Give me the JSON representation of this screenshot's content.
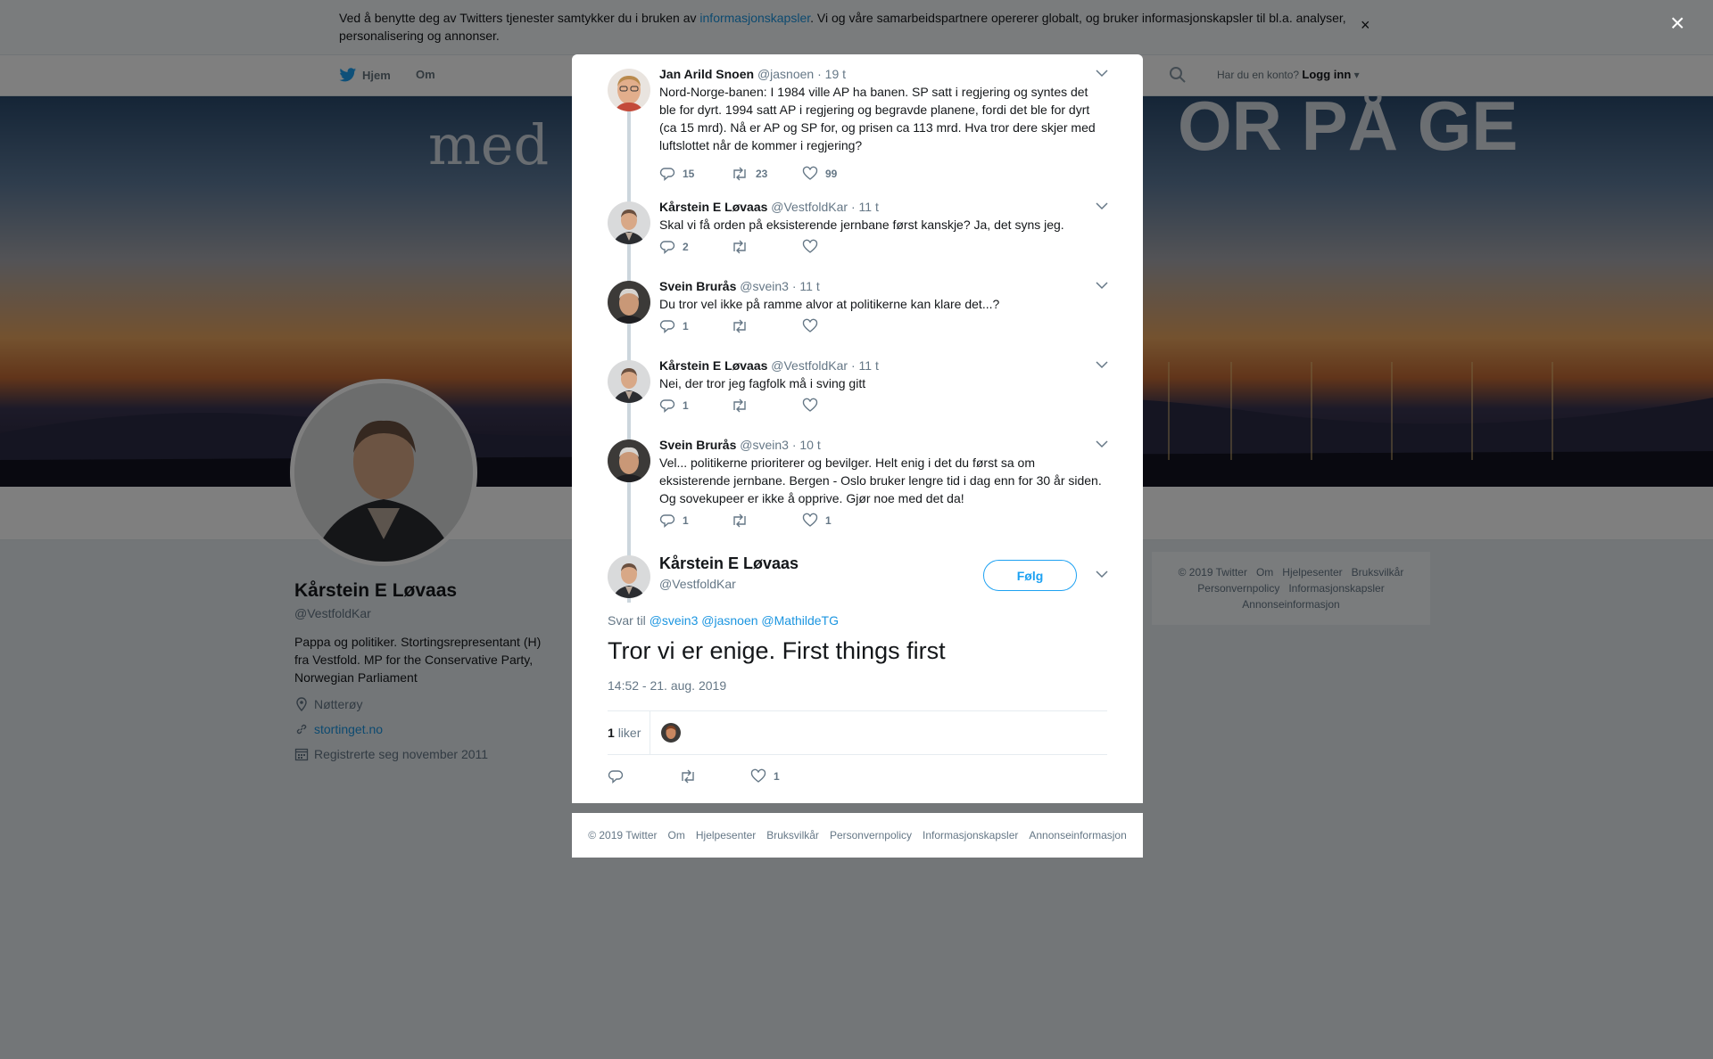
{
  "cookie_banner": {
    "text_before": "Ved å benytte deg av Twitters tjenester samtykker du i bruken av ",
    "link": "informasjonskapsler",
    "text_after": ". Vi og våre samarbeidspartnere opererer globalt, og bruker informasjonskapsler til bl.a. analyser, personalisering og annonser.",
    "close": "×"
  },
  "nav": {
    "home": "Hjem",
    "about": "Om",
    "account_prompt": "Har du en konto?",
    "login": "Logg inn"
  },
  "banner": {
    "line1": "med ",
    "line2": "OR PÅ GE"
  },
  "profile": {
    "name": "Kårstein E Løvaas",
    "handle": "@VestfoldKar",
    "bio": "Pappa og politiker. Stortingsrepresentant (H) fra Vestfold. MP for the Conservative Party, Norwegian Parliament",
    "location": "Nøtterøy",
    "url": "stortinget.no",
    "joined": "Registrerte seg november 2011"
  },
  "side_footer": [
    "© 2019 Twitter",
    "Om",
    "Hjelpesenter",
    "Bruksvilkår",
    "Personvernpolicy",
    "Informasjonskapsler",
    "Annonseinformasjon"
  ],
  "modal_close": "×",
  "thread": [
    {
      "name": "Jan Arild Snoen",
      "handle": "@jasnoen",
      "time": "· 19 t",
      "text": "Nord-Norge-banen: I 1984 ville AP ha banen. SP satt i regjering og syntes det ble for dyrt. 1994 satt AP i regjering og begravde planene, fordi det ble for dyrt (ca 15 mrd). Nå er AP og SP for, og prisen ca 113 mrd. Hva tror dere skjer med luftslottet når de kommer i regjering?",
      "replies": "15",
      "retweets": "23",
      "likes": "99"
    },
    {
      "name": "Kårstein E Løvaas",
      "handle": "@VestfoldKar",
      "time": "· 11 t",
      "text": "Skal vi få orden på eksisterende jernbane først kanskje? Ja, det syns jeg.",
      "replies": "2",
      "retweets": "",
      "likes": ""
    },
    {
      "name": "Svein Brurås",
      "handle": "@svein3",
      "time": "· 11 t",
      "text": "Du tror vel ikke på ramme alvor at politikerne kan klare det...?",
      "replies": "1",
      "retweets": "",
      "likes": ""
    },
    {
      "name": "Kårstein E Løvaas",
      "handle": "@VestfoldKar",
      "time": "· 11 t",
      "text": "Nei, der tror jeg fagfolk må i sving gitt",
      "replies": "1",
      "retweets": "",
      "likes": ""
    },
    {
      "name": "Svein Brurås",
      "handle": "@svein3",
      "time": "· 10 t",
      "text": "Vel... politikerne prioriterer og bevilger. Helt enig i det du først sa om eksisterende jernbane. Bergen - Oslo bruker lengre tid i dag enn for 30 år siden. Og sovekupeer er ikke å opprive. Gjør noe med det da!",
      "replies": "1",
      "retweets": "",
      "likes": "1"
    }
  ],
  "main_tweet": {
    "name": "Kårstein E Løvaas",
    "handle": "@VestfoldKar",
    "follow": "Følg",
    "reply_to_label": "Svar til",
    "mentions": [
      "@svein3",
      "@jasnoen",
      "@MathildeTG"
    ],
    "text": "Tror vi er enige. First things first",
    "timestamp": "14:52 - 21. aug. 2019",
    "likes_count": "1",
    "likes_label": "liker",
    "action_likes": "1"
  },
  "modal_footer": [
    "© 2019 Twitter",
    "Om",
    "Hjelpesenter",
    "Bruksvilkår",
    "Personvernpolicy",
    "Informasjonskapsler",
    "Annonseinformasjon"
  ],
  "colors": {
    "accent": "#1da1f2",
    "link": "#1b95e0",
    "muted": "#657786",
    "thread_line": "#ccd6dd"
  }
}
